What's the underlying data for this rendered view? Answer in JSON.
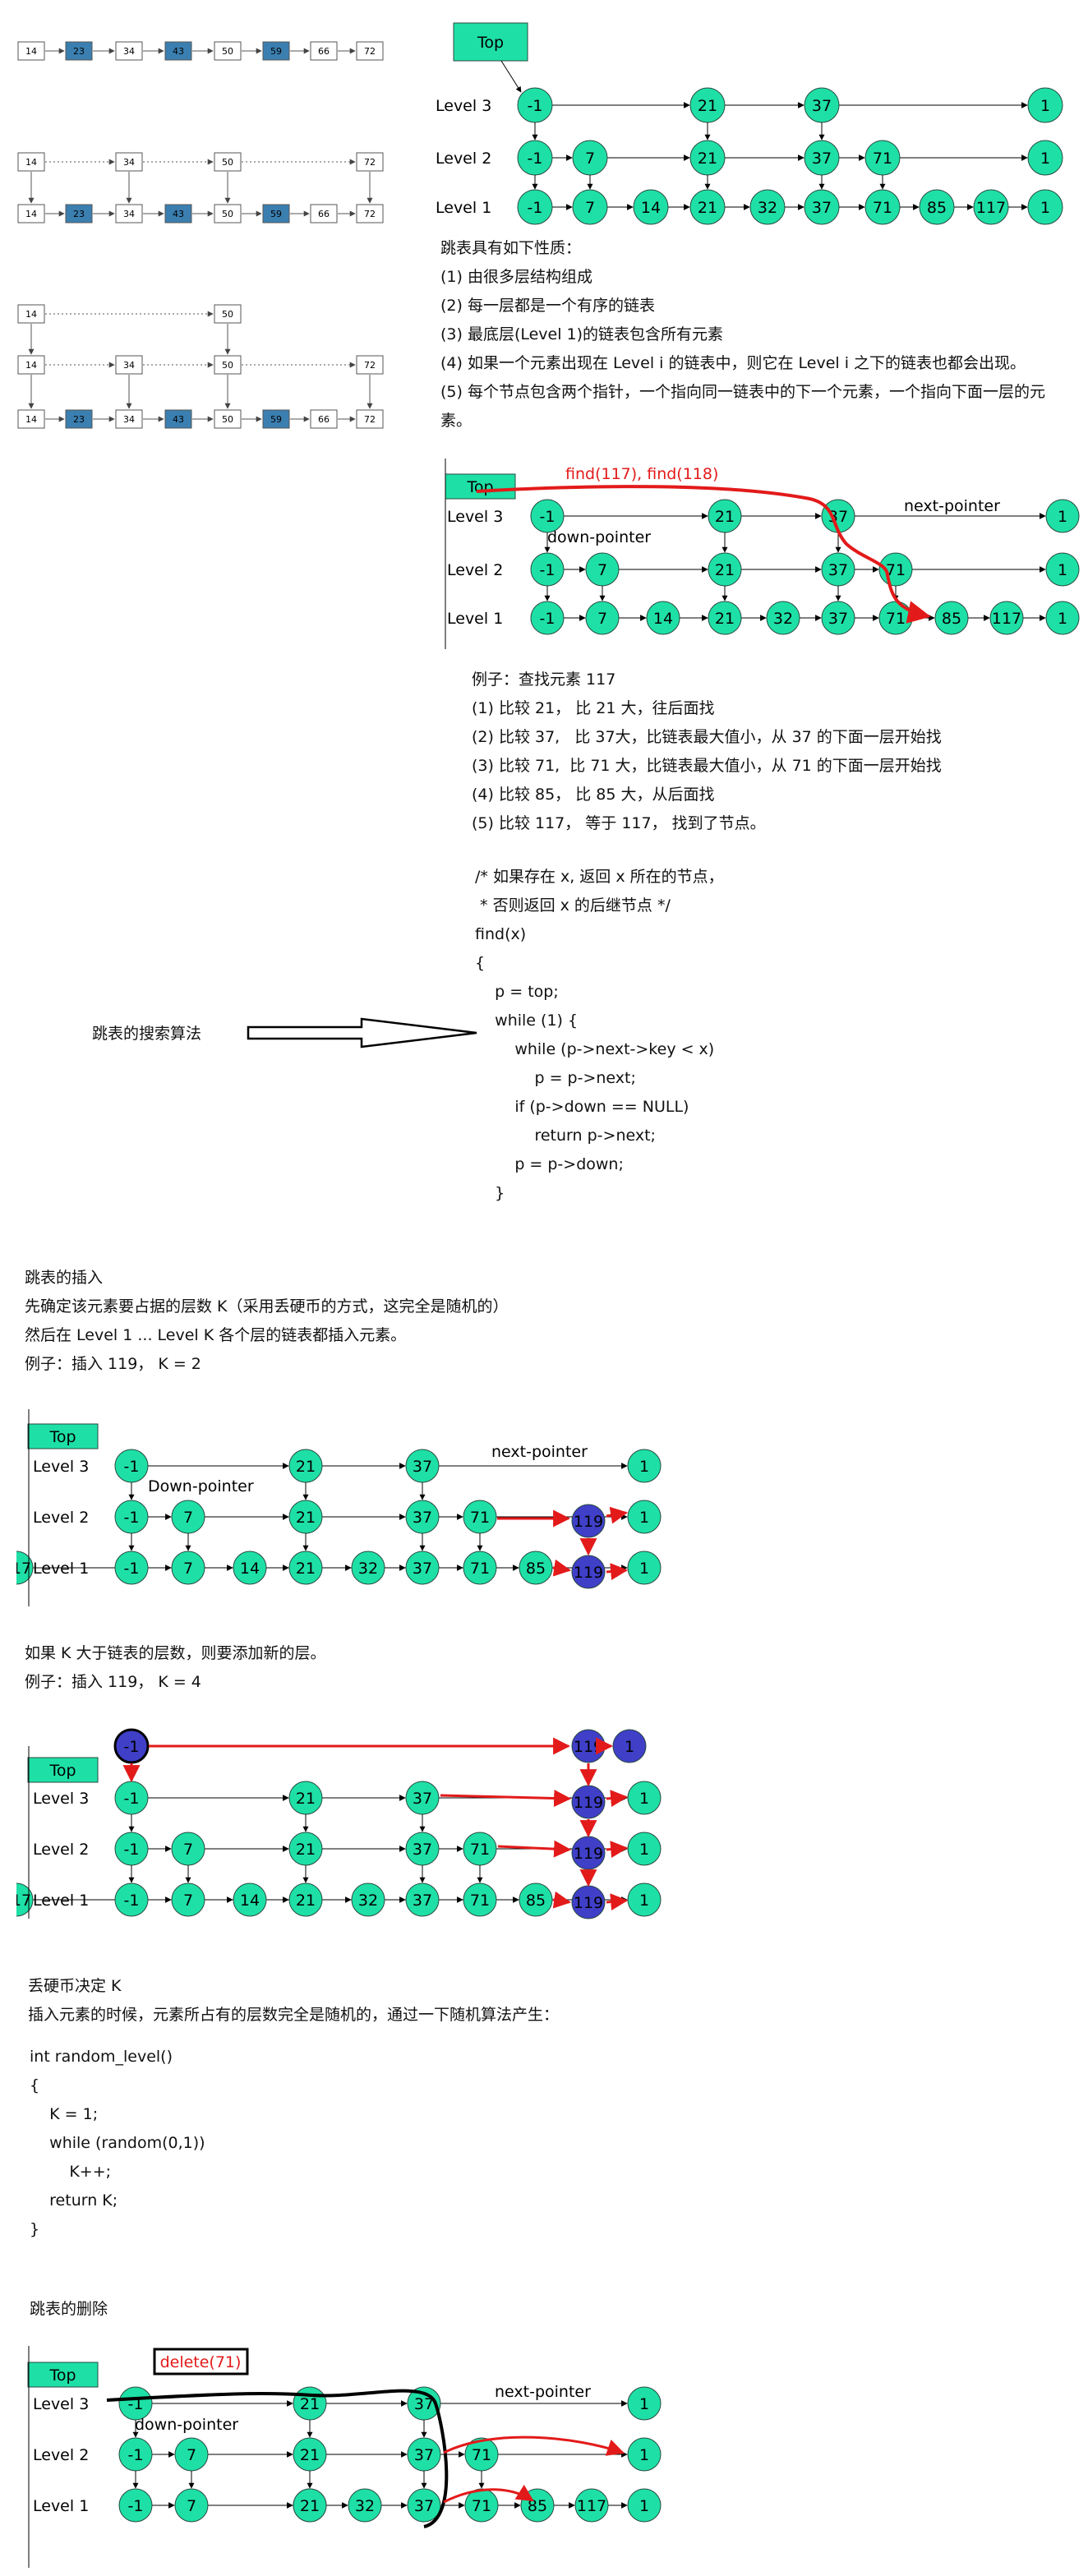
{
  "levels": {
    "l1": "Level 1",
    "l2": "Level 2",
    "l3": "Level 3"
  },
  "top_label": "Top",
  "list_values": {
    "top": [
      "14",
      "50"
    ],
    "mid": [
      "14",
      "34",
      "50",
      "72"
    ],
    "base": [
      "14",
      "23",
      "34",
      "43",
      "50",
      "59",
      "66",
      "72"
    ]
  },
  "skip_values": {
    "l3": [
      "-1",
      "21",
      "37",
      "1"
    ],
    "l2": [
      "-1",
      "7",
      "21",
      "37",
      "71",
      "1"
    ],
    "l1": [
      "-1",
      "7",
      "14",
      "21",
      "32",
      "37",
      "71",
      "85",
      "117",
      "1"
    ]
  },
  "insert_value": "119",
  "properties": {
    "title": "跳表具有如下性质：",
    "items": [
      "(1) 由很多层结构组成",
      "(2) 每一层都是一个有序的链表",
      "(3) 最底层(Level 1)的链表包含所有元素",
      "(4) 如果一个元素出现在 Level i 的链表中，则它在 Level i 之下的链表也都会出现。",
      "(5) 每个节点包含两个指针，一个指向同一链表中的下一个元素，一个指向下面一层的元",
      "素。"
    ]
  },
  "search": {
    "find_label": "find(117), find(118)",
    "next_pointer": "next-pointer",
    "down_pointer": "down-pointer",
    "example_lines": [
      "例子：查找元素 117",
      "(1) 比较 21， 比 21 大，往后面找",
      "(2) 比较 37,   比 37大，比链表最大值小，从 37 的下面一层开始找",
      "(3) 比较 71,  比 71 大，比链表最大值小，从 71 的下面一层开始找",
      "(4) 比较 85， 比 85 大，从后面找",
      "(5) 比较 117， 等于 117， 找到了节点。"
    ],
    "code_lines": [
      "/* 如果存在 x, 返回 x 所在的节点，",
      " * 否则返回 x 的后继节点 */",
      "find(x)",
      "{",
      "    p = top;",
      "    while (1) {",
      "        while (p->next->key < x)",
      "            p = p->next;",
      "        if (p->down == NULL)",
      "            return p->next;",
      "        p = p->down;",
      "    }"
    ],
    "algo_label": "跳表的搜索算法"
  },
  "insert": {
    "lines": [
      "跳表的插入",
      "先确定该元素要占据的层数 K（采用丢硬币的方式，这完全是随机的）",
      "然后在 Level 1 ... Level K 各个层的链表都插入元素。",
      "例子：插入 119， K = 2"
    ],
    "next_pointer": "next-pointer",
    "down_pointer": "Down-pointer",
    "k4_lines": [
      "如果 K 大于链表的层数，则要添加新的层。",
      "例子：插入 119， K = 4"
    ]
  },
  "coin": {
    "lines": [
      "丢硬币决定 K",
      "插入元素的时候，元素所占有的层数完全是随机的，通过一下随机算法产生："
    ],
    "code_lines": [
      "int random_level()",
      "{",
      "    K = 1;",
      "    while (random(0,1))",
      "        K++;",
      "    return K;",
      "}"
    ]
  },
  "delete": {
    "title": "跳表的删除",
    "label": "delete(71)",
    "next_pointer": "next-pointer",
    "down_pointer": "down-pointer"
  },
  "colors": {
    "node": "#1ee0a6",
    "highlight": "#3f3fc8",
    "red": "#e31a1a",
    "box": "#3b7fb0"
  }
}
